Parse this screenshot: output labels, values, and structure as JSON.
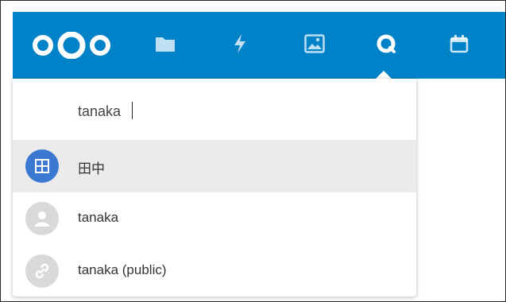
{
  "colors": {
    "brand": "#0082c9",
    "selected_row": "#ebebeb",
    "group_avatar": "#3b78d1",
    "placeholder_avatar": "#d9d9d9"
  },
  "header": {
    "logo": "nextcloud-logo",
    "nav": [
      {
        "name": "files",
        "icon": "folder-icon"
      },
      {
        "name": "activity",
        "icon": "lightning-icon"
      },
      {
        "name": "gallery",
        "icon": "image-icon"
      },
      {
        "name": "circles",
        "icon": "circles-icon",
        "active": true
      },
      {
        "name": "calendar",
        "icon": "calendar-icon"
      }
    ]
  },
  "search": {
    "value": "tanaka"
  },
  "results": [
    {
      "label": "田中",
      "icon": "group-icon",
      "selected": true
    },
    {
      "label": "tanaka",
      "icon": "user-icon"
    },
    {
      "label": "tanaka (public)",
      "icon": "link-icon"
    }
  ]
}
